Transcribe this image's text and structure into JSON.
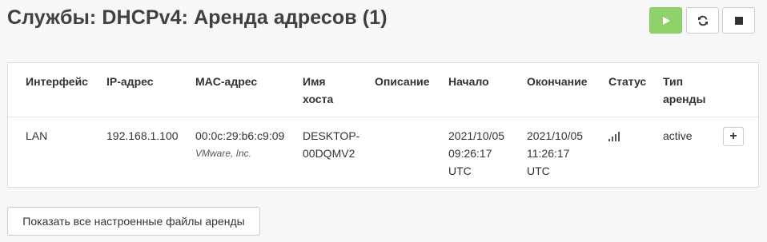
{
  "page": {
    "title": "Службы: DHCPv4: Аренда адресов (1)"
  },
  "service_controls": {
    "start_icon": "play-icon",
    "restart_icon": "refresh-icon",
    "stop_icon": "stop-icon",
    "start_color": "#8fd16b"
  },
  "table": {
    "headers": {
      "interface": "Интерфейс",
      "ip": "IP-адрес",
      "mac": "MAC-адрес",
      "hostname_line1": "Имя",
      "hostname_line2": "хоста",
      "description": "Описание",
      "start": "Начало",
      "end": "Окончание",
      "status": "Статус",
      "lease_type_line1": "Тип",
      "lease_type_line2": "аренды"
    },
    "rows": [
      {
        "interface": "LAN",
        "ip": "192.168.1.100",
        "mac": "00:0c:29:b6:c9:09",
        "vendor": "VMware, Inc.",
        "hostname_line1": "DESKTOP-",
        "hostname_line2": "00DQMV2",
        "description": "",
        "start_date": "2021/10/05",
        "start_time": "09:26:17",
        "start_tz": "UTC",
        "end_date": "2021/10/05",
        "end_time": "11:26:17",
        "end_tz": "UTC",
        "status_icon": "signal-bars-icon",
        "lease_type": "active",
        "action_label": "+"
      }
    ]
  },
  "footer": {
    "show_all_label": "Показать все настроенные файлы аренды"
  }
}
